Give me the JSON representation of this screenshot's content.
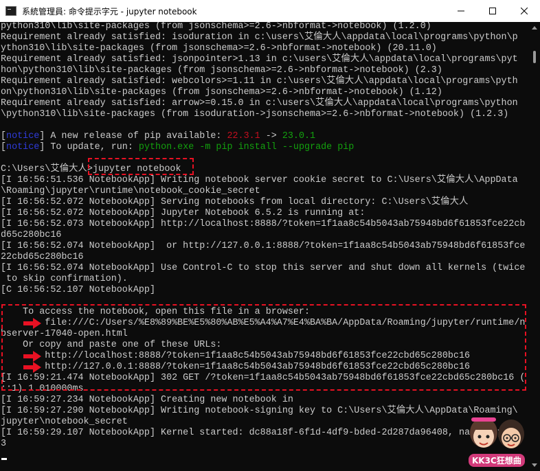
{
  "window": {
    "title": "系統管理員: 命令提示字元 - jupyter  notebook",
    "icon": "cmd-icon",
    "controls": [
      "minimize-icon",
      "maximize-icon",
      "close-icon"
    ]
  },
  "console": {
    "lines": [
      [
        {
          "t": "python310\\lib\\site-packages (from jsonschema>=2.6->nbformat->notebook) (1.2.0)"
        }
      ],
      [
        {
          "t": "Requirement already satisfied: isoduration in c:\\users\\艾倫大人\\appdata\\local\\programs\\python\\p"
        }
      ],
      [
        {
          "t": "ython310\\lib\\site-packages (from jsonschema>=2.6->nbformat->notebook) (20.11.0)"
        }
      ],
      [
        {
          "t": "Requirement already satisfied: jsonpointer>1.13 in c:\\users\\艾倫大人\\appdata\\local\\programs\\pyt"
        }
      ],
      [
        {
          "t": "hon\\python310\\lib\\site-packages (from jsonschema>=2.6->nbformat->notebook) (2.3)"
        }
      ],
      [
        {
          "t": "Requirement already satisfied: webcolors>=1.11 in c:\\users\\艾倫大人\\appdata\\local\\programs\\pyth"
        }
      ],
      [
        {
          "t": "on\\python310\\lib\\site-packages (from jsonschema>=2.6->nbformat->notebook) (1.12)"
        }
      ],
      [
        {
          "t": "Requirement already satisfied: arrow>=0.15.0 in c:\\users\\艾倫大人\\appdata\\local\\programs\\python"
        }
      ],
      [
        {
          "t": "\\python310\\lib\\site-packages (from isoduration->jsonschema>=2.6->nbformat->notebook) (1.2.3)"
        }
      ],
      [
        {
          "t": ""
        }
      ],
      [
        {
          "t": "["
        },
        {
          "t": "notice",
          "c": "notice"
        },
        {
          "t": "] A new release of pip available: "
        },
        {
          "t": "22.3.1",
          "c": "old"
        },
        {
          "t": " -> "
        },
        {
          "t": "23.0.1",
          "c": "new"
        }
      ],
      [
        {
          "t": "["
        },
        {
          "t": "notice",
          "c": "notice"
        },
        {
          "t": "] To update, run: "
        },
        {
          "t": "python.exe -m pip install --upgrade pip",
          "c": "cmd"
        }
      ],
      [
        {
          "t": ""
        }
      ],
      [
        {
          "t": "C:\\Users\\艾倫大人>jupyter notebook"
        }
      ],
      [
        {
          "t": "[I 16:56:51.536 NotebookApp] Writing notebook server cookie secret to C:\\Users\\艾倫大人\\AppData"
        }
      ],
      [
        {
          "t": "\\Roaming\\jupyter\\runtime\\notebook_cookie_secret"
        }
      ],
      [
        {
          "t": "[I 16:56:52.072 NotebookApp] Serving notebooks from local directory: C:\\Users\\艾倫大人"
        }
      ],
      [
        {
          "t": "[I 16:56:52.072 NotebookApp] Jupyter Notebook 6.5.2 is running at:"
        }
      ],
      [
        {
          "t": "[I 16:56:52.073 NotebookApp] http://localhost:8888/?token=1f1aa8c54b5043ab75948bd6f61853fce22cb"
        }
      ],
      [
        {
          "t": "d65c280bc16"
        }
      ],
      [
        {
          "t": "[I 16:56:52.074 NotebookApp]  or http://127.0.0.1:8888/?token=1f1aa8c54b5043ab75948bd6f61853fce"
        }
      ],
      [
        {
          "t": "22cbd65c280bc16"
        }
      ],
      [
        {
          "t": "[I 16:56:52.074 NotebookApp] Use Control-C to stop this server and shut down all kernels (twice"
        }
      ],
      [
        {
          "t": " to skip confirmation)."
        }
      ],
      [
        {
          "t": "[C 16:56:52.107 NotebookApp]"
        }
      ],
      [
        {
          "t": ""
        }
      ],
      [
        {
          "t": "    To access the notebook, open this file in a browser:"
        }
      ],
      [
        {
          "t": "        file:///C:/Users/%E8%89%BE%E5%80%AB%E5%A4%A7%E4%BA%BA/AppData/Roaming/jupyter/runtime/n"
        }
      ],
      [
        {
          "t": "bserver-17040-open.html"
        }
      ],
      [
        {
          "t": "    Or copy and paste one of these URLs:"
        }
      ],
      [
        {
          "t": "        http://localhost:8888/?token=1f1aa8c54b5043ab75948bd6f61853fce22cbd65c280bc16"
        }
      ],
      [
        {
          "t": "        http://127.0.0.1:8888/?token=1f1aa8c54b5043ab75948bd6f61853fce22cbd65c280bc16"
        }
      ],
      [
        {
          "t": "[I 16:59:21.474 NotebookApp] 302 GET /?token=1f1aa8c54b5043ab75948bd6f61853fce22cbd65c280bc16 ("
        }
      ],
      [
        {
          "t": "::1) 1.010000ms"
        }
      ],
      [
        {
          "t": "[I 16:59:27.234 NotebookApp] Creating new notebook in"
        }
      ],
      [
        {
          "t": "[I 16:59:27.290 NotebookApp] Writing notebook-signing key to C:\\Users\\艾倫大人\\AppData\\Roaming\\"
        }
      ],
      [
        {
          "t": "jupyter\\notebook_secret"
        }
      ],
      [
        {
          "t": "[I 16:59:29.107 NotebookApp] Kernel started: dc88a18f-6f1d-4df9-bded-2d287da96408, name: pytho"
        }
      ],
      [
        {
          "t": "3"
        }
      ]
    ]
  },
  "annotations": {
    "color": "#e81123",
    "arrow_icon": "red-arrow-right-icon"
  },
  "watermark": {
    "text": "KK3C狂想曲",
    "icon": "cartoon-faces-logo"
  },
  "colors": {
    "background": "#0c0c0c",
    "foreground": "#cccccc",
    "notice": "#2f3bdb",
    "old_version": "#c50f1f",
    "new_version": "#13a10e"
  }
}
